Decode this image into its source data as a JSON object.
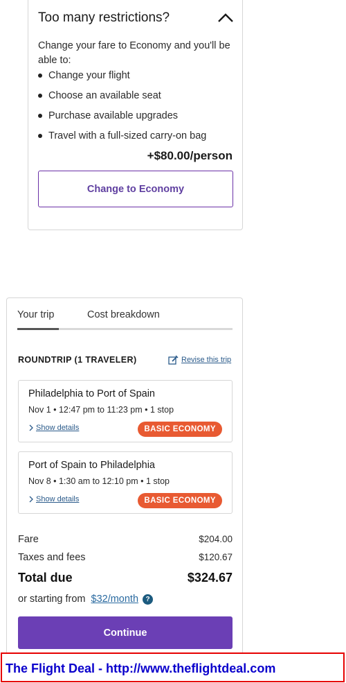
{
  "restrictions": {
    "title": "Too many restrictions?",
    "intro": "Change your fare to Economy and you'll be able to:",
    "benefits": [
      "Change your flight",
      "Choose an available seat",
      "Purchase available upgrades",
      "Travel with a full-sized carry-on bag"
    ],
    "price": "+$80.00/person",
    "button_label": "Change to Economy"
  },
  "trip": {
    "tabs": [
      "Your trip",
      "Cost breakdown"
    ],
    "active_tab": "Your trip",
    "roundtrip_label": "ROUNDTRIP (1 TRAVELER)",
    "revise_label": "Revise this trip",
    "segments": [
      {
        "route": "Philadelphia to Port of Spain",
        "time": "Nov 1 • 12:47 pm to 11:23 pm • 1 stop",
        "details_label": "Show details",
        "badge": "BASIC ECONOMY"
      },
      {
        "route": "Port of Spain to Philadelphia",
        "time": "Nov 8 • 1:30 am to 12:10 pm • 1 stop",
        "details_label": "Show details",
        "badge": "BASIC ECONOMY"
      }
    ],
    "fare_label": "Fare",
    "fare_value": "$204.00",
    "taxes_label": "Taxes and fees",
    "taxes_value": "$120.67",
    "total_label": "Total due",
    "total_value": "$324.67",
    "starting_prefix": "or starting from",
    "starting_link": "$32/month",
    "help_glyph": "?",
    "continue_label": "Continue"
  },
  "banner": {
    "text": "The Flight Deal - http://www.theflightdeal.com"
  },
  "colors": {
    "accent_purple": "#6b3fb5",
    "badge_orange": "#e85a32",
    "link_blue": "#2a6aa0",
    "banner_red": "#e60000",
    "banner_text": "#0a00cc"
  },
  "icons": {
    "collapse": "chevron-up-icon",
    "revise": "edit-icon",
    "details": "chevron-right-icon",
    "help": "help-icon"
  }
}
